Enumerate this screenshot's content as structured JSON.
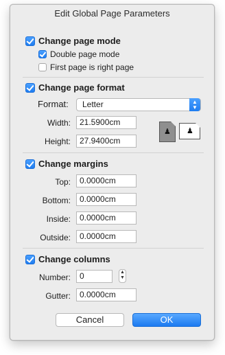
{
  "dialog": {
    "title": "Edit Global Page Parameters"
  },
  "page_mode": {
    "label": "Change page mode",
    "checked": true,
    "double_page": {
      "label": "Double page mode",
      "checked": true
    },
    "first_right": {
      "label": "First page is right page",
      "checked": false
    }
  },
  "page_format": {
    "label": "Change page format",
    "checked": true,
    "format_label": "Format:",
    "format_value": "Letter",
    "width_label": "Width:",
    "width_value": "21.5900cm",
    "height_label": "Height:",
    "height_value": "27.9400cm",
    "orientation_icons": [
      "portrait-orientation-icon",
      "landscape-orientation-icon"
    ]
  },
  "margins": {
    "label": "Change margins",
    "checked": true,
    "top_label": "Top:",
    "top_value": "0.0000cm",
    "bottom_label": "Bottom:",
    "bottom_value": "0.0000cm",
    "inside_label": "Inside:",
    "inside_value": "0.0000cm",
    "outside_label": "Outside:",
    "outside_value": "0.0000cm"
  },
  "columns": {
    "label": "Change columns",
    "checked": true,
    "number_label": "Number:",
    "number_value": "0",
    "gutter_label": "Gutter:",
    "gutter_value": "0.0000cm"
  },
  "buttons": {
    "cancel": "Cancel",
    "ok": "OK"
  },
  "colors": {
    "accent": "#1f7df0",
    "dialog_bg": "#ececec"
  }
}
